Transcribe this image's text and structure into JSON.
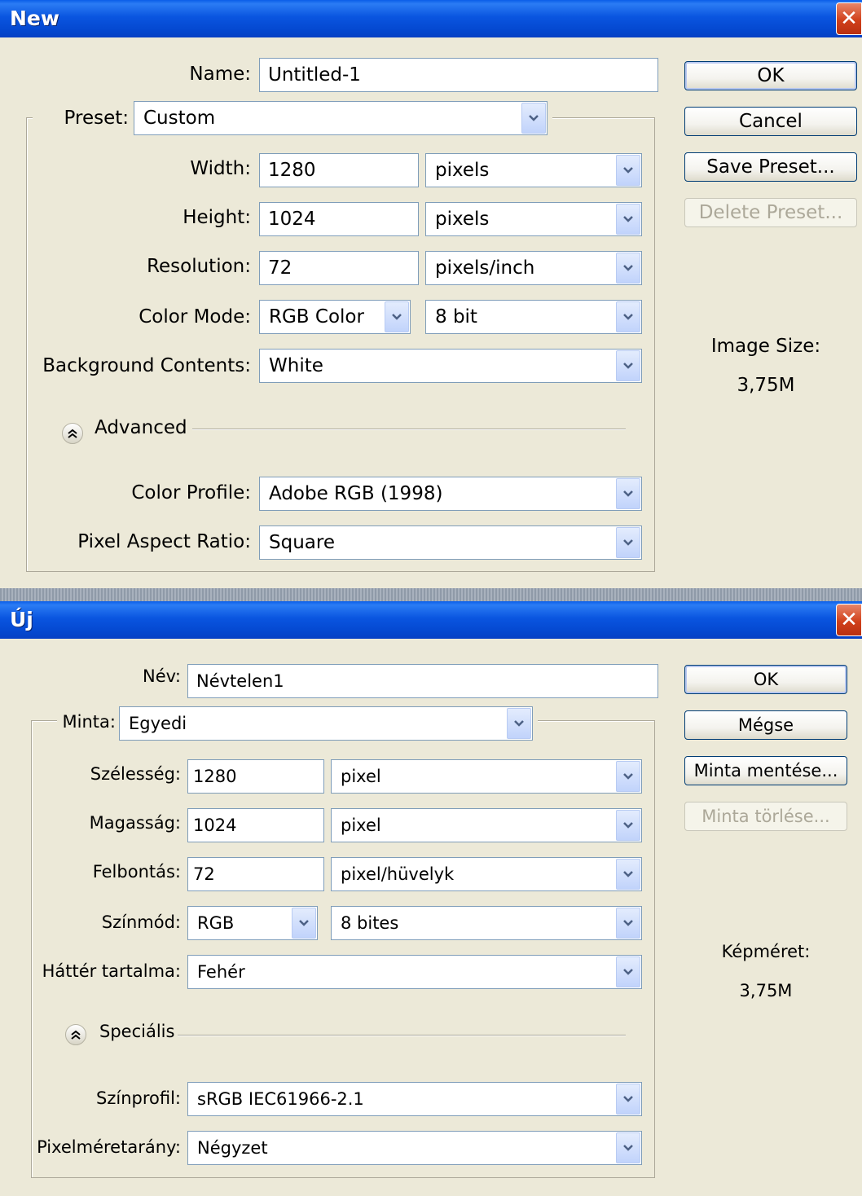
{
  "dialog_en": {
    "title": "New",
    "name_label": "Name:",
    "name_value": "Untitled-1",
    "preset_label": "Preset:",
    "preset_value": "Custom",
    "width_label": "Width:",
    "width_value": "1280",
    "width_unit": "pixels",
    "height_label": "Height:",
    "height_value": "1024",
    "height_unit": "pixels",
    "resolution_label": "Resolution:",
    "resolution_value": "72",
    "resolution_unit": "pixels/inch",
    "color_mode_label": "Color Mode:",
    "color_mode_value": "RGB Color",
    "bit_depth_value": "8 bit",
    "background_label": "Background Contents:",
    "background_value": "White",
    "advanced_label": "Advanced",
    "color_profile_label": "Color Profile:",
    "color_profile_value": "Adobe RGB (1998)",
    "pixel_aspect_label": "Pixel Aspect Ratio:",
    "pixel_aspect_value": "Square",
    "ok_label": "OK",
    "cancel_label": "Cancel",
    "save_preset_label": "Save Preset...",
    "delete_preset_label": "Delete Preset...",
    "image_size_label": "Image Size:",
    "image_size_value": "3,75M"
  },
  "dialog_hu": {
    "title": "Új",
    "name_label": "Név:",
    "name_value": "Névtelen1",
    "preset_label": "Minta:",
    "preset_value": "Egyedi",
    "width_label": "Szélesség:",
    "width_value": "1280",
    "width_unit": "pixel",
    "height_label": "Magasság:",
    "height_value": "1024",
    "height_unit": "pixel",
    "resolution_label": "Felbontás:",
    "resolution_value": "72",
    "resolution_unit": "pixel/hüvelyk",
    "color_mode_label": "Színmód:",
    "color_mode_value": "RGB",
    "bit_depth_value": "8 bites",
    "background_label": "Háttér tartalma:",
    "background_value": "Fehér",
    "advanced_label": "Speciális",
    "color_profile_label": "Színprofil:",
    "color_profile_value": "sRGB IEC61966-2.1",
    "pixel_aspect_label": "Pixelméretarány:",
    "pixel_aspect_value": "Négyzet",
    "ok_label": "OK",
    "cancel_label": "Mégse",
    "save_preset_label": "Minta mentése...",
    "delete_preset_label": "Minta törlése...",
    "image_size_label": "Képméret:",
    "image_size_value": "3,75M"
  },
  "colors": {
    "titlebar": "#0a55e0",
    "dialog_bg": "#ece9d8",
    "close_button": "#d1411b",
    "field_border": "#7f9db9"
  },
  "icons": {
    "close": "close-icon",
    "dropdown": "chevron-down-icon",
    "advanced_toggle": "double-chevron-up-icon"
  }
}
